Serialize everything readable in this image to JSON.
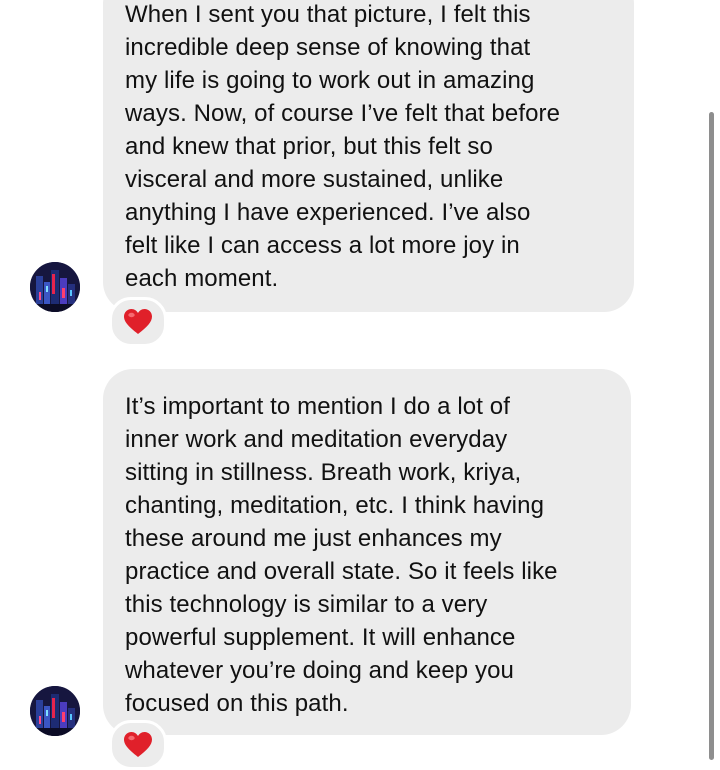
{
  "messages": [
    {
      "text": "When I sent you that picture, I felt this\nincredible deep sense of knowing that\nmy life is going to work out in amazing\nways. Now, of course I’ve felt that before\nand knew that prior, but this felt so\nvisceral and more sustained, unlike\nanything I have experienced. I’ve also\nfelt like I can access a lot more joy in\neach moment.",
      "reaction": "heart-icon"
    },
    {
      "text": "It’s important to mention I do a lot of\ninner work and meditation everyday\nsitting in stillness. Breath work, kriya,\nchanting, meditation, etc. I think having\nthese around me just enhances my\npractice and overall state. So it feels like\nthis technology is similar to a very\npowerful supplement. It will enhance\nwhatever you’re doing and keep you\nfocused on this path.",
      "reaction": "heart-icon"
    }
  ],
  "colors": {
    "bubble": "#ececec",
    "text": "#111111",
    "heart": "#e0202a",
    "background": "#ffffff"
  }
}
